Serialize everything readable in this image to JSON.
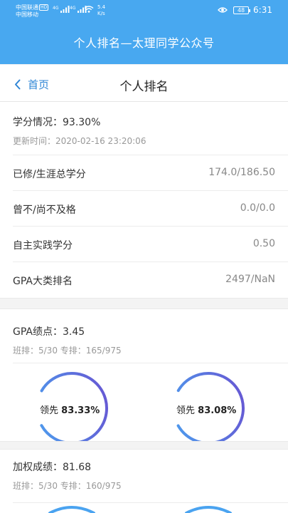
{
  "status_bar": {
    "carrier1": "中国联通",
    "carrier1_badge": "HD",
    "carrier2": "中国移动",
    "net1": "4G",
    "net2": "4G",
    "speed_value": "5.4",
    "speed_unit": "K/s",
    "battery": "48",
    "time": "6:31"
  },
  "header": {
    "title": "个人排名—太理同学公众号"
  },
  "nav": {
    "back_label": "首页",
    "title": "个人排名"
  },
  "credit": {
    "label": "学分情况：",
    "value": "93.30%",
    "updated": "更新时间：2020-02-16 23:20:06"
  },
  "rows": [
    {
      "label": "已修/生涯总学分",
      "value": "174.0/186.50"
    },
    {
      "label": "曾不/尚不及格",
      "value": "0.0/0.0"
    },
    {
      "label": "自主实践学分",
      "value": "0.50"
    },
    {
      "label": "GPA大类排名",
      "value": "2497/NaN"
    }
  ],
  "gpa": {
    "label": "GPA绩点：",
    "value": "3.45",
    "rank": "班排：5/30 专排：165/975",
    "ring1": {
      "prefix": "领先",
      "value": "83.33%",
      "fraction": 0.8333
    },
    "ring2": {
      "prefix": "领先",
      "value": "83.08%",
      "fraction": 0.8308
    }
  },
  "weighted": {
    "label": "加权成绩：",
    "value": "81.68",
    "rank": "班排：5/30 专排：160/975"
  },
  "colors": {
    "header": "#48a8f0",
    "link": "#2f86d6",
    "ring_start": "#4aa3f0",
    "ring_end": "#6a4fd0"
  }
}
